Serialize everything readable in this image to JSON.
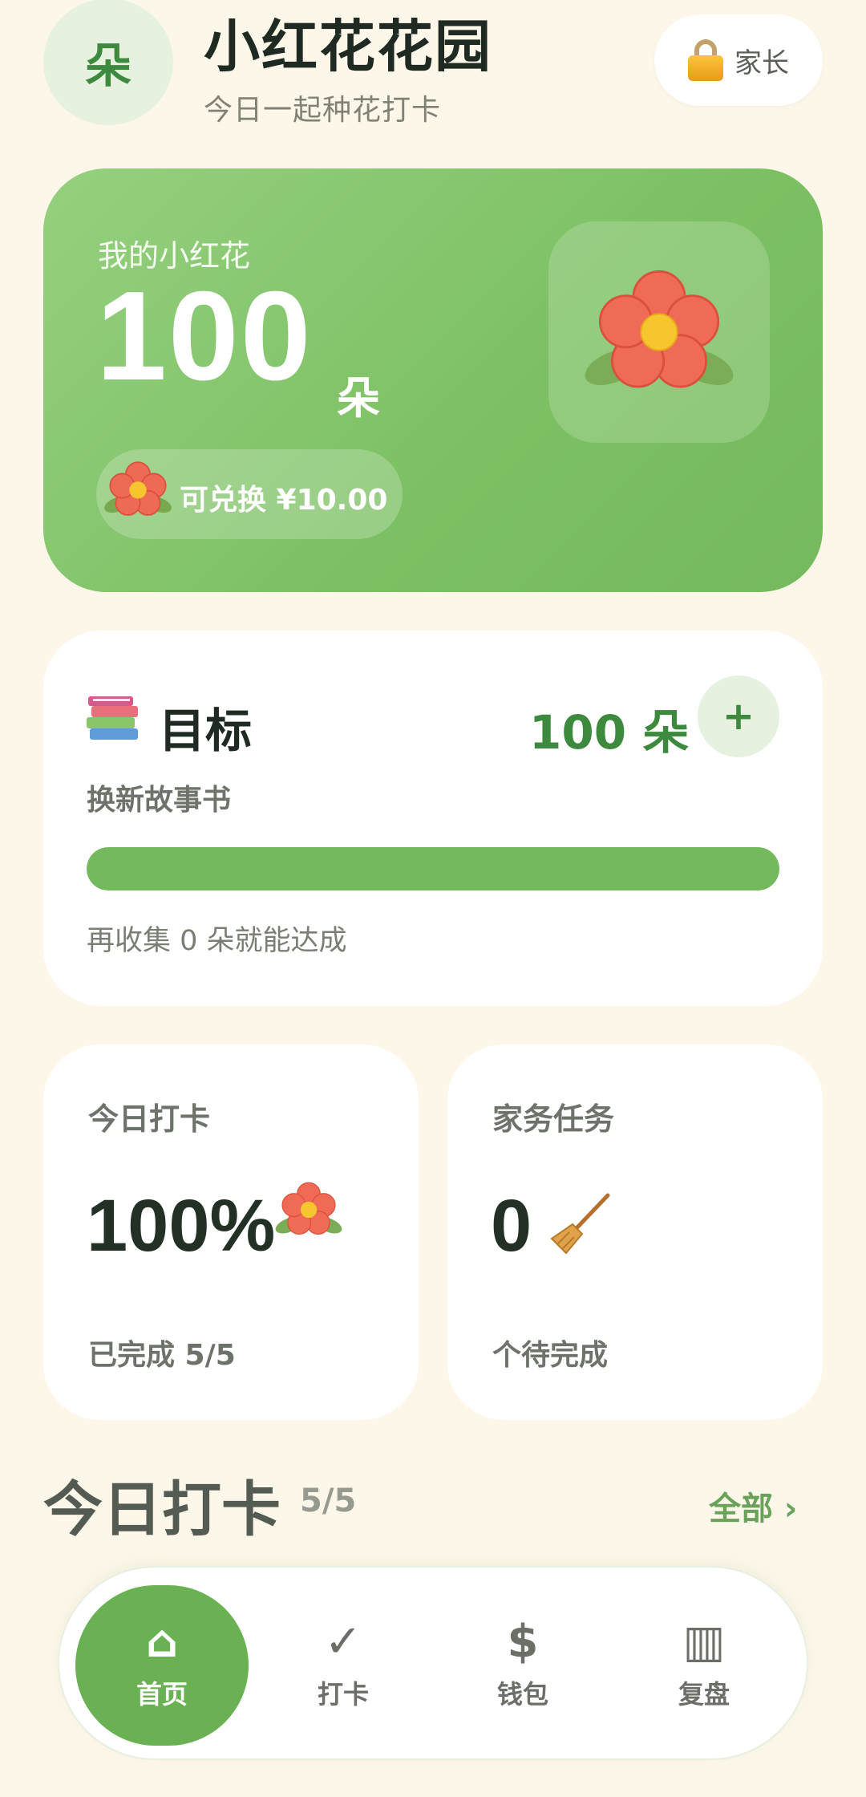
{
  "header": {
    "avatar_char": "朵",
    "title": "小红花花园",
    "subtitle": "今日一起种花打卡",
    "parent_button_label": "家长",
    "parent_button_icon": "lock-icon"
  },
  "flowers": {
    "label": "我的小红花",
    "count": "100",
    "unit": "朵",
    "redeem_text": "可兑换 ¥10.00",
    "icon": "flower-icon"
  },
  "goal": {
    "icon": "books-icon",
    "title": "目标",
    "target": "100 朵",
    "add_label": "+",
    "name": "换新故事书",
    "progress": 1.0,
    "remaining_text": "再收集 0 朵就能达成"
  },
  "stats": {
    "checkin": {
      "title": "今日打卡",
      "value": "100%",
      "icon": "flower-icon",
      "sub": "已完成 5/5"
    },
    "chores": {
      "title": "家务任务",
      "value": "0",
      "icon": "broom-icon",
      "sub": "个待完成"
    }
  },
  "section": {
    "title": "今日打卡",
    "count": "5/5",
    "all_label": "全部 ›"
  },
  "nav": {
    "items": [
      {
        "label": "首页",
        "icon": "⌂",
        "icon_name": "home-icon",
        "active": true
      },
      {
        "label": "打卡",
        "icon": "✓",
        "icon_name": "check-icon",
        "active": false
      },
      {
        "label": "钱包",
        "icon": "$",
        "icon_name": "wallet-icon",
        "active": false
      },
      {
        "label": "复盘",
        "icon": "▥",
        "icon_name": "review-icon",
        "active": false
      }
    ]
  },
  "colors": {
    "background": "#fdf7ea",
    "primary_green": "#74b95c",
    "dark_green": "#3d8a3e",
    "card_white": "#ffffff",
    "flower_red": "#ef6a55",
    "flower_center": "#f7c62f"
  }
}
